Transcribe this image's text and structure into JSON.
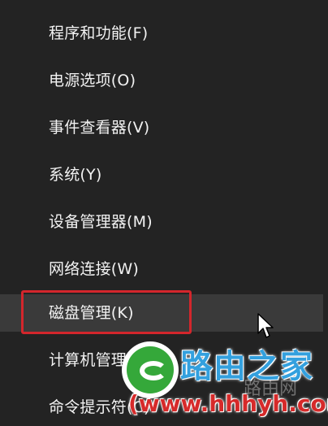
{
  "menu": {
    "items": [
      {
        "label": "程序和功能(F)"
      },
      {
        "label": "电源选项(O)"
      },
      {
        "label": "事件查看器(V)"
      },
      {
        "label": "系统(Y)"
      },
      {
        "label": "设备管理器(M)"
      },
      {
        "label": "网络连接(W)"
      },
      {
        "label": "磁盘管理(K)"
      },
      {
        "label": "计算机管理(G)"
      },
      {
        "label": "命令提示符(C)"
      }
    ]
  },
  "watermark": {
    "title": "路由之家",
    "url": "(www.hhhyh.com)",
    "faint": "路由网"
  },
  "colors": {
    "highlight": "#d3262c",
    "menu_background": "#232323",
    "menu_text": "#f2f2f2",
    "watermark_green": "#35a83a",
    "watermark_blue": "#33a0de",
    "watermark_red": "#d62a2a"
  }
}
